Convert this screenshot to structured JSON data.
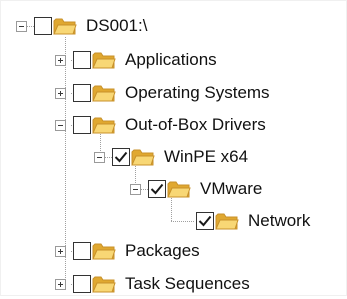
{
  "tree": {
    "nodes": [
      {
        "label": "DS001:\\",
        "checked": false,
        "expander": "expanded",
        "icon": "folder-icon"
      },
      {
        "label": "Applications",
        "checked": false,
        "expander": "collapsed",
        "icon": "folder-icon"
      },
      {
        "label": "Operating Systems",
        "checked": false,
        "expander": "collapsed",
        "icon": "folder-icon"
      },
      {
        "label": "Out-of-Box Drivers",
        "checked": false,
        "expander": "expanded",
        "icon": "folder-icon"
      },
      {
        "label": "WinPE x64",
        "checked": true,
        "expander": "expanded",
        "icon": "folder-icon"
      },
      {
        "label": "VMware",
        "checked": true,
        "expander": "expanded",
        "icon": "folder-icon"
      },
      {
        "label": "Network",
        "checked": true,
        "expander": "none",
        "icon": "folder-icon"
      },
      {
        "label": "Packages",
        "checked": false,
        "expander": "collapsed",
        "icon": "folder-icon"
      },
      {
        "label": "Task Sequences",
        "checked": false,
        "expander": "collapsed",
        "icon": "folder-icon"
      }
    ]
  },
  "colors": {
    "folder_light": "#F8D775",
    "folder_dark": "#E0A830",
    "folder_edge": "#C8912A",
    "check": "#1a1a1a",
    "lines": "#a0a0a0"
  }
}
